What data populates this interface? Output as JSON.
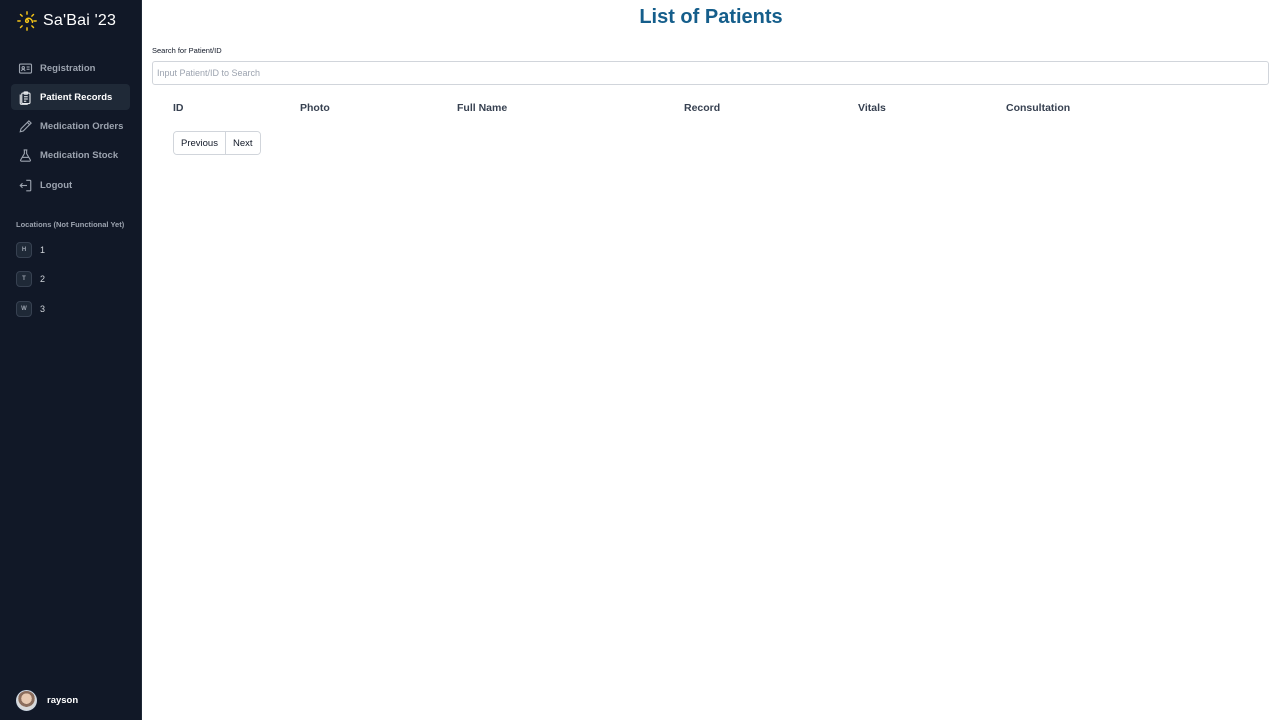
{
  "brand": {
    "name": "Sa'Bai '23",
    "logo_icon": "sun-spiral-icon",
    "logo_color": "#f5c518"
  },
  "sidebar": {
    "items": [
      {
        "label": "Registration",
        "icon": "id-card-icon",
        "active": false
      },
      {
        "label": "Patient Records",
        "icon": "clipboard-icon",
        "active": true
      },
      {
        "label": "Medication Orders",
        "icon": "pencil-icon",
        "active": false
      },
      {
        "label": "Medication Stock",
        "icon": "flask-icon",
        "active": false
      },
      {
        "label": "Logout",
        "icon": "logout-icon",
        "active": false
      }
    ],
    "locations_heading": "Locations (Not Functional Yet)",
    "locations": [
      {
        "badge": "H",
        "label": "1"
      },
      {
        "badge": "T",
        "label": "2"
      },
      {
        "badge": "W",
        "label": "3"
      }
    ],
    "user": {
      "name": "rayson"
    }
  },
  "main": {
    "title": "List of Patients",
    "search": {
      "label": "Search for Patient/ID",
      "placeholder": "Input Patient/ID to Search",
      "value": ""
    },
    "table": {
      "columns": [
        "ID",
        "Photo",
        "Full Name",
        "Record",
        "Vitals",
        "Consultation"
      ]
    },
    "pagination": {
      "previous_label": "Previous",
      "next_label": "Next"
    }
  },
  "colors": {
    "sidebar_bg": "#111827",
    "active_item_bg": "#1f2937",
    "title_color": "#155e8b"
  }
}
